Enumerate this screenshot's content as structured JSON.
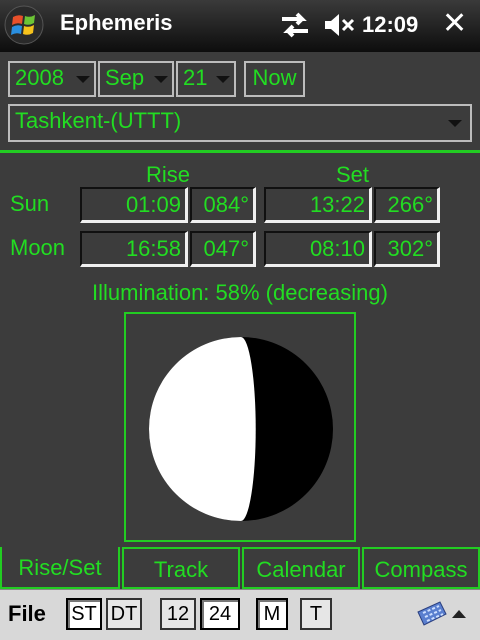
{
  "titlebar": {
    "app_title": "Ephemeris",
    "time": "12:09",
    "close_label": "✕"
  },
  "controls": {
    "year": "2008",
    "month": "Sep",
    "day": "21",
    "now_label": "Now",
    "location": "Tashkent-(UTTT)"
  },
  "table": {
    "rise_header": "Rise",
    "set_header": "Set",
    "rows": [
      {
        "label": "Sun",
        "rise_time": "01:09",
        "rise_az": "084°",
        "set_time": "13:22",
        "set_az": "266°"
      },
      {
        "label": "Moon",
        "rise_time": "16:58",
        "rise_az": "047°",
        "set_time": "08:10",
        "set_az": "302°"
      }
    ]
  },
  "illumination": {
    "text": "Illumination: 58% (decreasing)",
    "fraction": 0.58,
    "phase": "decreasing"
  },
  "tabs": [
    {
      "label": "Rise/Set",
      "active": true
    },
    {
      "label": "Track",
      "active": false
    },
    {
      "label": "Calendar",
      "active": false
    },
    {
      "label": "Compass",
      "active": false
    }
  ],
  "menubar": {
    "file_label": "File",
    "buttons": [
      {
        "label": "ST",
        "pressed": true
      },
      {
        "label": "DT",
        "pressed": false
      },
      {
        "label": "12",
        "pressed": false
      },
      {
        "label": "24",
        "pressed": true
      },
      {
        "label": "M",
        "pressed": true
      },
      {
        "label": "T",
        "pressed": false
      }
    ]
  },
  "colors": {
    "accent_green": "#22dd22",
    "background": "#3c3c3c",
    "titlebar": "#1a1a1a"
  },
  "icons": [
    "windows-start-icon",
    "connectivity-icon",
    "volume-muted-icon",
    "close-icon",
    "dropdown-arrow-icon",
    "keyboard-icon"
  ]
}
